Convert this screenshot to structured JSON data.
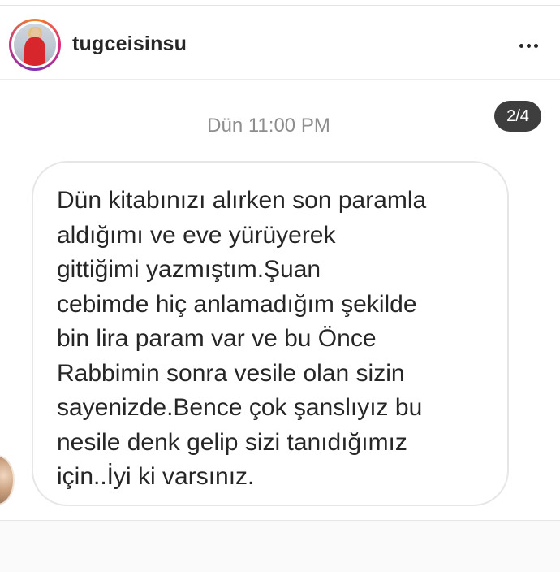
{
  "header": {
    "username": "tugceisinsu",
    "more_icon": "more-horizontal-icon"
  },
  "thread": {
    "timestamp": "Dün 11:00 PM",
    "page_indicator": "2/4",
    "message": {
      "text": "Dün kitabınızı alırken son paramla\naldığımı ve eve yürüyerek\ngittiğimi yazmıştım.Şuan\ncebimde hiç anlamadığım şekilde\nbin lira param var ve bu Önce\nRabbimin sonra vesile olan sizin\nsayenizde.Bence çok şanslıyız bu\nnesile denk gelip sizi tanıdığımız\niçin..İyi ki varsınız."
    }
  },
  "colors": {
    "text": "#262626",
    "muted": "#8e8e8e",
    "badge_bg": "#3e3e3e",
    "bubble_border": "#e6e6e6"
  }
}
